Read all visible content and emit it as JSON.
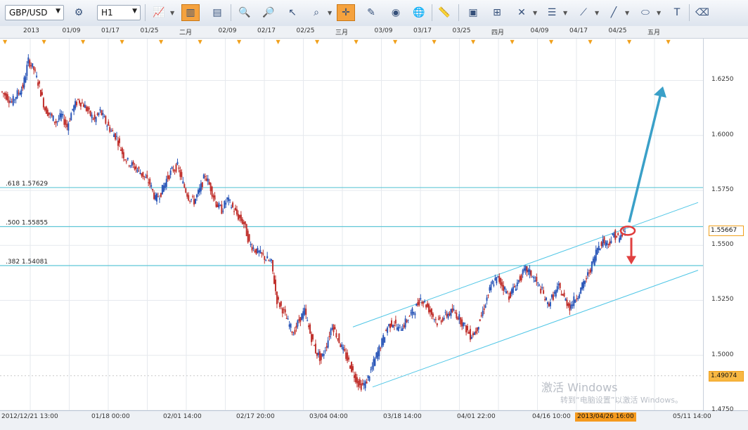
{
  "toolbar": {
    "symbol": "GBP/USD",
    "timeframe": "H1"
  },
  "top_dates": [
    "2013",
    "01/09",
    "01/17",
    "01/25",
    "二月",
    "02/09",
    "02/17",
    "02/25",
    "三月",
    "03/09",
    "03/17",
    "03/25",
    "四月",
    "04/09",
    "04/17",
    "04/25",
    "五月"
  ],
  "bottom_dates": [
    "2012/12/21 13:00",
    "01/18 00:00",
    "02/01 14:00",
    "02/17 20:00",
    "03/04 04:00",
    "03/18 14:00",
    "04/01 22:00",
    "04/16 10:00",
    "05/11 14:00"
  ],
  "cursor_date": "2013/04/26 16:00",
  "watermark": {
    "line1": "激活 Windows",
    "line2": "转到“电脑设置”以激活 Windows。"
  },
  "chart_data": {
    "type": "line",
    "instrument": "GBP/USD",
    "interval": "H1",
    "ylim": [
      1.475,
      1.644
    ],
    "y_ticks": [
      1.625,
      1.6,
      1.575,
      1.55,
      1.525,
      1.5,
      1.475
    ],
    "y_tick_labels": [
      "1.6250",
      "1.6000",
      "1.5750",
      "1.5500",
      "1.5250",
      "1.5000",
      "1.4750"
    ],
    "current_price": 1.55667,
    "current_price_label": "1.55667",
    "marker_price": 1.49074,
    "marker_price_label": "1.49074",
    "series": [
      {
        "values": [
          1.62,
          1.618,
          1.615,
          1.619,
          1.622,
          1.634,
          1.63,
          1.622,
          1.612,
          1.609,
          1.606,
          1.609,
          1.604,
          1.612,
          1.616,
          1.614,
          1.61,
          1.607,
          1.611,
          1.606,
          1.602,
          1.599,
          1.592,
          1.588,
          1.586,
          1.584,
          1.581,
          1.578,
          1.571,
          1.574,
          1.58,
          1.584,
          1.586,
          1.578,
          1.572,
          1.57,
          1.575,
          1.582,
          1.576,
          1.569,
          1.566,
          1.571,
          1.567,
          1.563,
          1.56,
          1.551,
          1.548,
          1.546,
          1.544,
          1.542,
          1.525,
          1.521,
          1.515,
          1.51,
          1.516,
          1.52,
          1.51,
          1.502,
          1.498,
          1.505,
          1.514,
          1.508,
          1.502,
          1.497,
          1.491,
          1.486,
          1.487,
          1.493,
          1.5,
          1.506,
          1.513,
          1.515,
          1.512,
          1.514,
          1.518,
          1.521,
          1.526,
          1.523,
          1.519,
          1.515,
          1.517,
          1.519,
          1.52,
          1.517,
          1.513,
          1.509,
          1.511,
          1.518,
          1.526,
          1.533,
          1.535,
          1.531,
          1.527,
          1.531,
          1.535,
          1.539,
          1.537,
          1.533,
          1.529,
          1.523,
          1.527,
          1.531,
          1.526,
          1.522,
          1.526,
          1.53,
          1.535,
          1.541,
          1.549,
          1.552,
          1.551,
          1.555,
          1.553,
          1.557
        ]
      }
    ],
    "fibonacci_levels": [
      {
        "label": ".618  1.57629",
        "value": 1.57629
      },
      {
        "label": ".500  1.55855",
        "value": 1.55855
      },
      {
        "label": ".382  1.54081",
        "value": 1.54081
      }
    ],
    "channel": {
      "upper": [
        {
          "x": 0.502,
          "y": 1.5129
        },
        {
          "x": 0.993,
          "y": 1.5695
        }
      ],
      "lower": [
        {
          "x": 0.53,
          "y": 1.4856
        },
        {
          "x": 0.993,
          "y": 1.5387
        }
      ]
    },
    "arrows": [
      {
        "direction": "up",
        "color": "#3aa0c8"
      },
      {
        "direction": "down",
        "color": "#e04040"
      }
    ]
  }
}
